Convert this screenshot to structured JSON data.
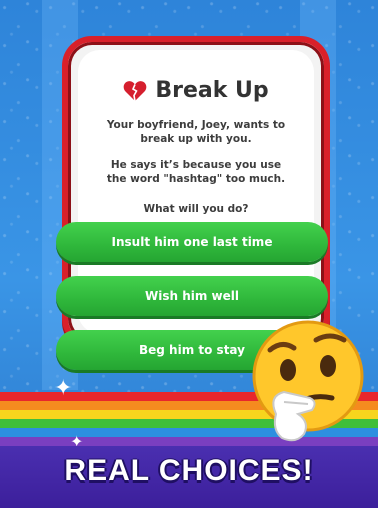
{
  "card": {
    "title": "Break Up",
    "message_line1": "Your boyfriend, Joey, wants to break up with you.",
    "message_line2": "He says it’s because you use the word \"hashtag\" too much.",
    "question": "What will you do?"
  },
  "choices": [
    {
      "label": "Insult him one last time"
    },
    {
      "label": "Wish him well"
    },
    {
      "label": "Beg him to stay"
    }
  ],
  "banner": {
    "tagline": "REAL CHOICES!"
  },
  "icons": {
    "card_icon": "broken-heart-icon",
    "mascot": "thinking-face-emoji"
  },
  "colors": {
    "background_blue": "#2e84d9",
    "card_border_red": "#d9202a",
    "choice_green": "#2fb73b",
    "bottom_purple": "#3c1f9b",
    "emoji_yellow": "#ffc72b"
  }
}
